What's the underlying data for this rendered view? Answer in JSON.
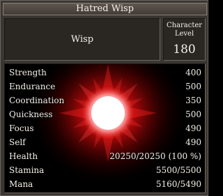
{
  "window": {
    "title": "Hatred Wisp"
  },
  "creature": {
    "name": "Wisp",
    "level_label": "Character Level",
    "level": "180",
    "image": "wisp-glow-image"
  },
  "stats": [
    {
      "label": "Strength",
      "value": "400"
    },
    {
      "label": "Endurance",
      "value": "500"
    },
    {
      "label": "Coordination",
      "value": "350"
    },
    {
      "label": "Quickness",
      "value": "500"
    },
    {
      "label": "Focus",
      "value": "490"
    },
    {
      "label": "Self",
      "value": "490"
    },
    {
      "label": "Health",
      "value": "20250/20250 (100 %)"
    },
    {
      "label": "Stamina",
      "value": "5500/5500"
    },
    {
      "label": "Mana",
      "value": "5160/5490"
    }
  ],
  "colors": {
    "frame": "#3a3632",
    "panel": "#2a2622",
    "text": "#f4f0e8",
    "glow": "#ff1a1a"
  }
}
